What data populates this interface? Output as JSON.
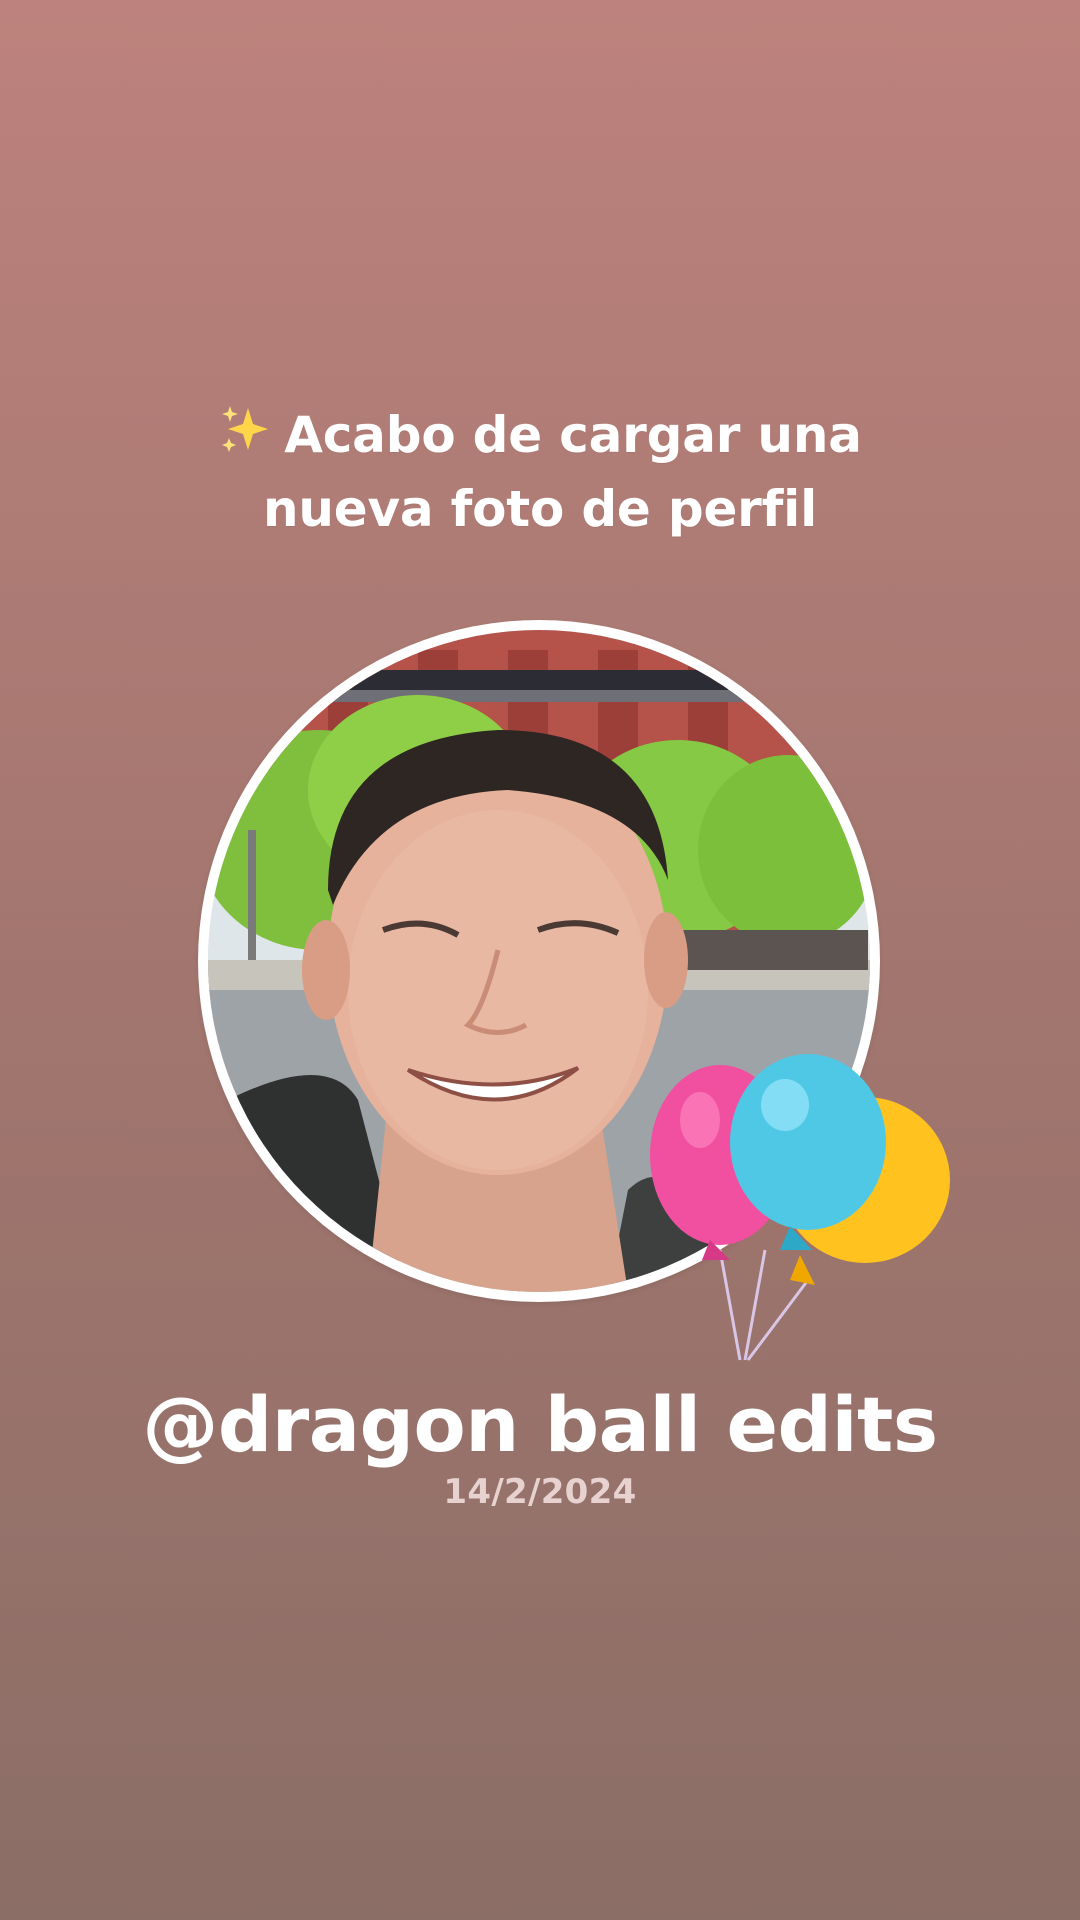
{
  "story": {
    "headline_line1": "Acabo de cargar una",
    "headline_line2": "nueva foto de perfil",
    "sparkle_icon": "sparkles-emoji",
    "username": "@dragon ball edits",
    "date": "14/2/2024"
  },
  "colors": {
    "background_top": "#bd827d",
    "background_bottom": "#8b6e66",
    "balloon_pink": "#f0509f",
    "balloon_blue": "#4fc8e6",
    "balloon_yellow": "#ffc21f"
  }
}
